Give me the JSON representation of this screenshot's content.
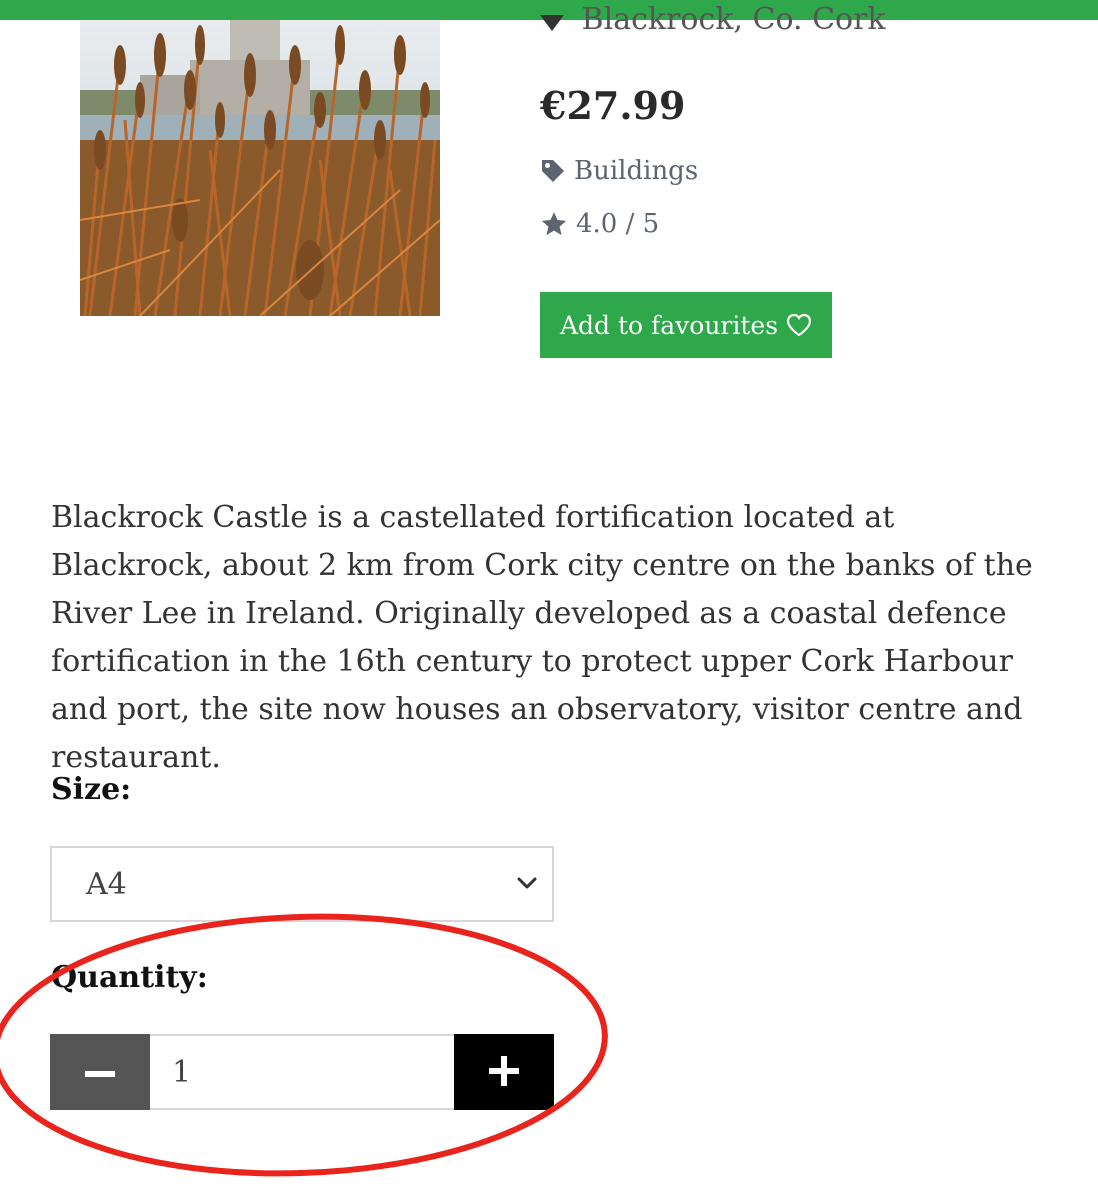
{
  "product": {
    "location": "Blackrock, Co. Cork",
    "price": "€27.99",
    "category": "Buildings",
    "rating": "4.0 / 5",
    "rating_value": 4.0,
    "favourite_label": "Add to favourites",
    "image_alt": "Blackrock Castle behind orange grasses"
  },
  "description": "Blackrock Castle is a castellated fortification located at Blackrock, about 2 km from Cork city centre on the banks of the River Lee in Ireland. Originally developed as a coastal defence fortification in the 16th century to protect upper Cork Harbour and port, the site now houses an observatory, visitor centre and restaurant.",
  "options": {
    "size_label": "Size:",
    "size_selected": "A4",
    "quantity_label": "Quantity:",
    "quantity_value": "1"
  },
  "colors": {
    "brand_green": "#2ea84a",
    "minus_button": "#555555",
    "plus_button": "#000000",
    "annotation_red": "#e8241d"
  },
  "icons": {
    "location": "map-pin-icon",
    "category": "tag-icon",
    "rating": "star-icon",
    "favourite": "heart-outline-icon",
    "select": "chevron-down-icon",
    "minus": "minus-icon",
    "plus": "plus-icon"
  }
}
